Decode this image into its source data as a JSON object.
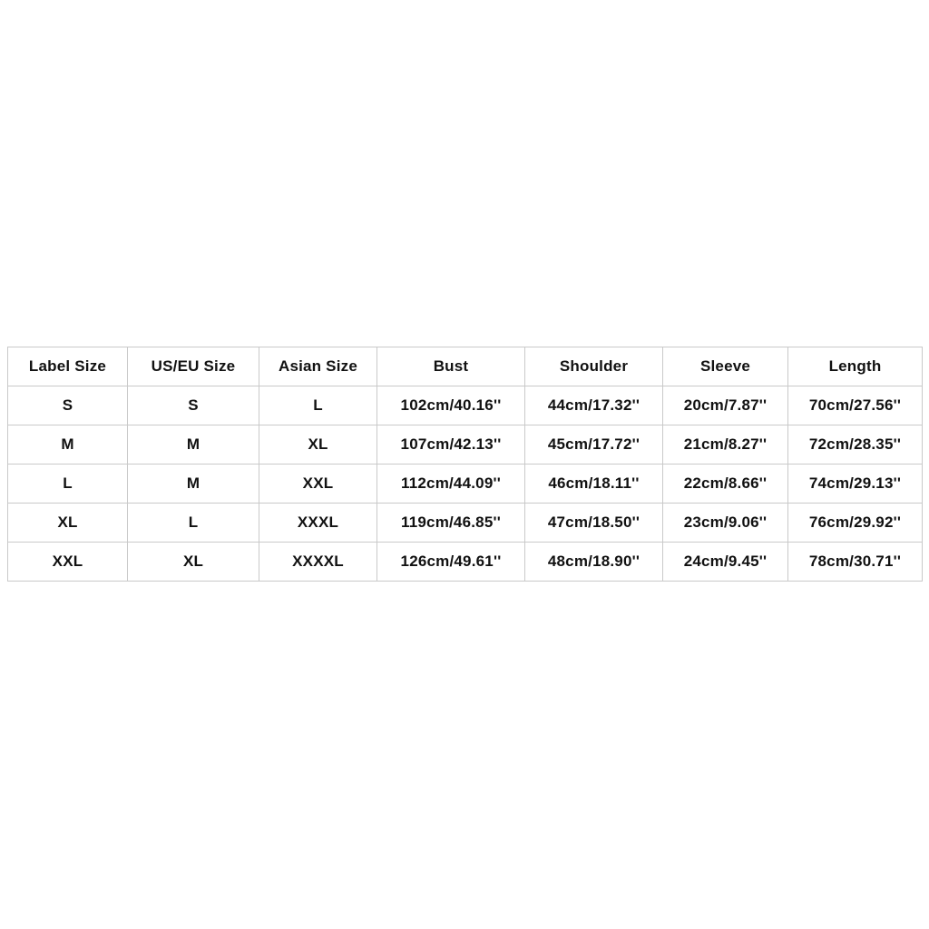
{
  "table": {
    "headers": [
      "Label Size",
      "US/EU Size",
      "Asian Size",
      "Bust",
      "Shoulder",
      "Sleeve",
      "Length"
    ],
    "rows": [
      {
        "label_size": "S",
        "us_eu_size": "S",
        "asian_size": "L",
        "bust": "102cm/40.16''",
        "shoulder": "44cm/17.32''",
        "sleeve": "20cm/7.87''",
        "length": "70cm/27.56''"
      },
      {
        "label_size": "M",
        "us_eu_size": "M",
        "asian_size": "XL",
        "bust": "107cm/42.13''",
        "shoulder": "45cm/17.72''",
        "sleeve": "21cm/8.27''",
        "length": "72cm/28.35''"
      },
      {
        "label_size": "L",
        "us_eu_size": "M",
        "asian_size": "XXL",
        "bust": "112cm/44.09''",
        "shoulder": "46cm/18.11''",
        "sleeve": "22cm/8.66''",
        "length": "74cm/29.13''"
      },
      {
        "label_size": "XL",
        "us_eu_size": "L",
        "asian_size": "XXXL",
        "bust": "119cm/46.85''",
        "shoulder": "47cm/18.50''",
        "sleeve": "23cm/9.06''",
        "length": "76cm/29.92''"
      },
      {
        "label_size": "XXL",
        "us_eu_size": "XL",
        "asian_size": "XXXXL",
        "bust": "126cm/49.61''",
        "shoulder": "48cm/18.90''",
        "sleeve": "24cm/9.45''",
        "length": "78cm/30.71''"
      }
    ]
  },
  "colors": {
    "background": "#ffffff",
    "border": "#c9c9c9",
    "text": "#111111"
  }
}
